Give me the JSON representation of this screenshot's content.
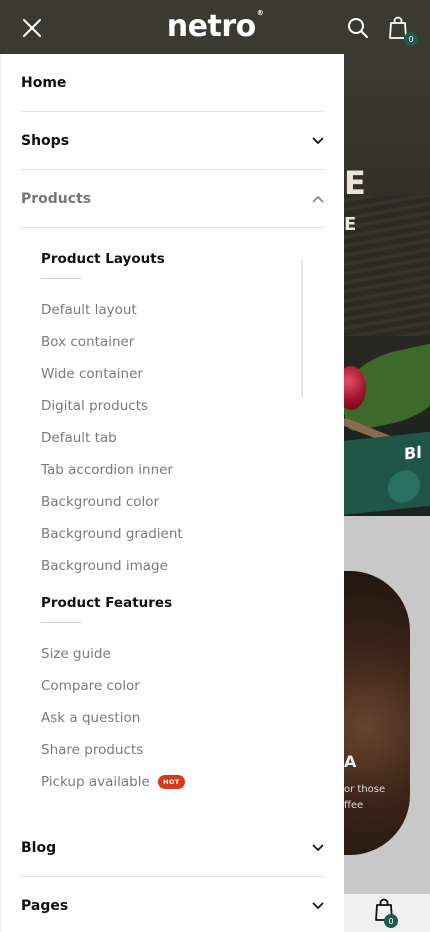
{
  "header": {
    "logo": "netro",
    "logo_mark": "®",
    "cart_count": "0"
  },
  "background": {
    "hero_letter": "E",
    "hero_letter2": "E",
    "band_text": "Bl",
    "card_title": "A",
    "card_line1": "or those",
    "card_line2": "ffee",
    "bottom_cart_count": "0"
  },
  "menu": {
    "home": "Home",
    "shops": "Shops",
    "products": "Products",
    "blog": "Blog",
    "pages": "Pages"
  },
  "products_submenu": {
    "layouts_heading": "Product Layouts",
    "layouts": [
      "Default layout",
      "Box container",
      "Wide container",
      "Digital products",
      "Default tab",
      "Tab accordion inner",
      "Background color",
      "Background gradient",
      "Background image"
    ],
    "features_heading": "Product Features",
    "features": [
      "Size guide",
      "Compare color",
      "Ask a question",
      "Share products",
      "Pickup available"
    ],
    "hot_badge": "HOT"
  },
  "colors": {
    "header_bg": "#3a3a30",
    "accent_teal": "#1e5a4e",
    "hot_badge": "#d8381e"
  },
  "icons": {
    "close": "close-icon",
    "search": "search-icon",
    "cart": "shopping-bag-icon",
    "chevron_down": "chevron-down-icon",
    "chevron_up": "chevron-up-icon"
  }
}
